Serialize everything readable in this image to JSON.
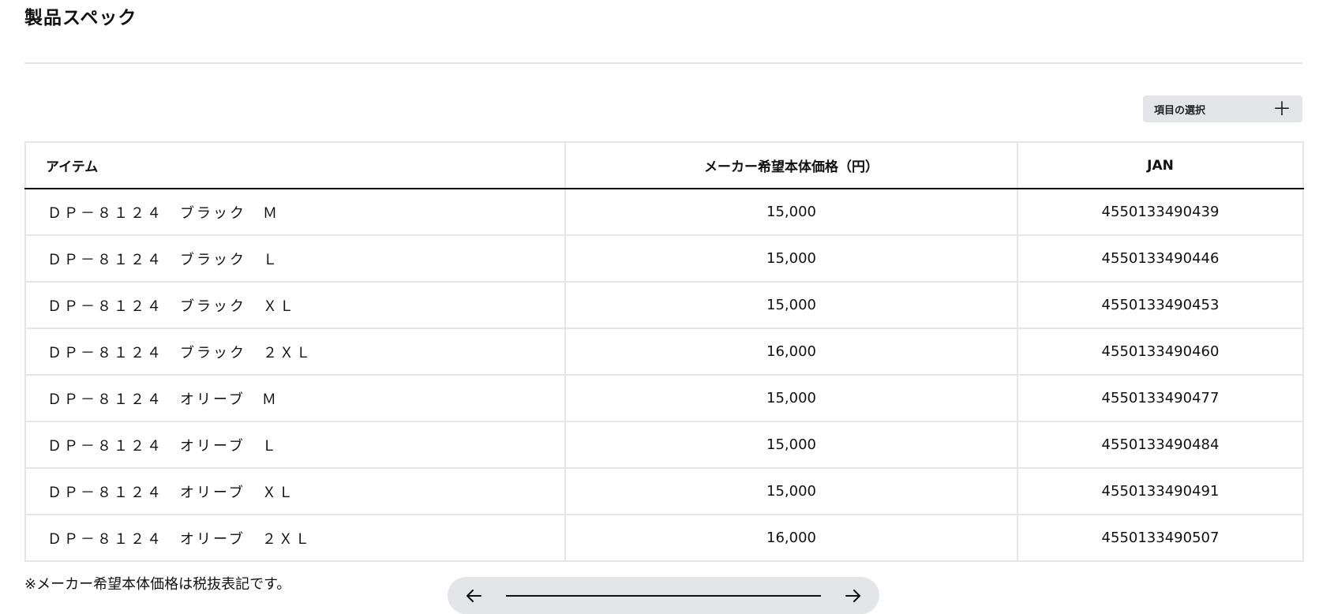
{
  "page": {
    "title": "製品スペック"
  },
  "toolbar": {
    "select_items_label": "項目の選択",
    "select_items_icon": "plus-icon"
  },
  "table": {
    "headers": [
      "アイテム",
      "メーカー希望本体価格（円）",
      "JAN"
    ],
    "rows": [
      {
        "item": "ＤＰ－８１２４　ブラック　Ｍ",
        "price": "15,000",
        "jan": "4550133490439"
      },
      {
        "item": "ＤＰ－８１２４　ブラック　Ｌ",
        "price": "15,000",
        "jan": "4550133490446"
      },
      {
        "item": "ＤＰ－８１２４　ブラック　ＸＬ",
        "price": "15,000",
        "jan": "4550133490453"
      },
      {
        "item": "ＤＰ－８１２４　ブラック　２ＸＬ",
        "price": "16,000",
        "jan": "4550133490460"
      },
      {
        "item": "ＤＰ－８１２４　オリーブ　Ｍ",
        "price": "15,000",
        "jan": "4550133490477"
      },
      {
        "item": "ＤＰ－８１２４　オリーブ　Ｌ",
        "price": "15,000",
        "jan": "4550133490484"
      },
      {
        "item": "ＤＰ－８１２４　オリーブ　ＸＬ",
        "price": "15,000",
        "jan": "4550133490491"
      },
      {
        "item": "ＤＰ－８１２４　オリーブ　２ＸＬ",
        "price": "16,000",
        "jan": "4550133490507"
      }
    ]
  },
  "footer": {
    "note": "※メーカー希望本体価格は税抜表記です。"
  },
  "scroller": {
    "left_icon": "arrow-left-icon",
    "right_icon": "arrow-right-icon"
  },
  "colors": {
    "border": "#e6e6e6",
    "button_bg": "#e3e5e8",
    "text": "#111111"
  }
}
